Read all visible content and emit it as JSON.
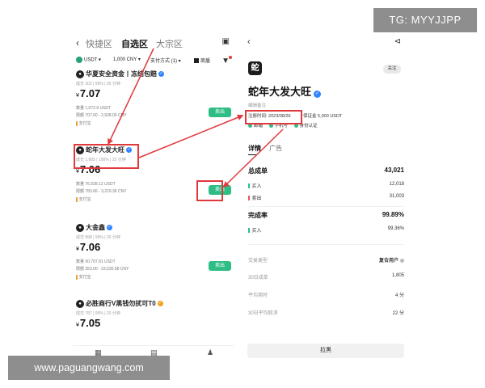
{
  "watermarks": {
    "telegram": "TG: MYYJJPP",
    "site": "www.paguangwang.com"
  },
  "left_panel": {
    "tabs": [
      "快捷区",
      "自选区",
      "大宗区"
    ],
    "active_tab": "自选区",
    "filter": {
      "asset": "USDT",
      "amount": "1,000 CNY",
      "payment": "支付方式 (1)",
      "checkbox_label": "商盾"
    },
    "offers": [
      {
        "name": "华夏安全资金丨冻结包赔",
        "stats": "成交 302   |   99%   |   20 分钟",
        "price": "7.07",
        "currency_symbol": "¥",
        "quantity": "数量  1,072.9 USDT",
        "limit": "限额  707.00 - 2,928.00 CNY",
        "payment": "支付宝",
        "action": "卖出",
        "badge": "blue"
      },
      {
        "name": "蛇年大发大旺",
        "stats": "成交 1,805  |  100%  |  22 分钟",
        "price": "7.06",
        "currency_symbol": "¥",
        "quantity": "数量  76,028.12 USDT",
        "limit": "限额  783.66 - 3,219.36 CNY",
        "payment": "支付宝",
        "action": "卖出",
        "badge": "blue"
      },
      {
        "name": "大金鑫",
        "stats": "成交 898   |   99%   |   20 分钟",
        "price": "7.06",
        "currency_symbol": "¥",
        "quantity": "数量  50,707.81 USDT",
        "limit": "限额  353.00 - 23,530.98 CNY",
        "payment": "支付宝",
        "action": "卖出",
        "badge": "blue"
      },
      {
        "name": "必胜商行V黑钱勿扰可T0",
        "stats": "成交 787   |   99%   |   20 分钟",
        "price": "7.05",
        "currency_symbol": "¥",
        "badge": "gold"
      }
    ]
  },
  "right_panel": {
    "avatar_char": "蛇",
    "follow_label": "关注",
    "merchant_name": "蛇年大发大旺",
    "remark": "编辑备注",
    "registration": "注册时间: 2023/08/26",
    "deposit": "保证金  5,000 USDT",
    "auth": [
      "邮箱",
      "手机号",
      "身份认证"
    ],
    "tabs": [
      "详情",
      "广告"
    ],
    "active_tab": "详情",
    "total_orders": {
      "label": "总成单",
      "value": "43,021"
    },
    "buy": {
      "label": "买入",
      "value": "12,018"
    },
    "sell": {
      "label": "卖出",
      "value": "31,003"
    },
    "completion": {
      "label": "完成率",
      "value": "99.89%"
    },
    "buy_rate": {
      "label": "买入",
      "value": "99.36%"
    },
    "trade_type": {
      "label": "交易类型",
      "value": "复合用户"
    },
    "orders_30d": {
      "label": "30日成单",
      "value": "1,805"
    },
    "avg_time": {
      "label": "平均用时",
      "value": "4 分"
    },
    "avg_cancel_30d": {
      "label": "30日平均取消",
      "value": "22 分"
    },
    "block_label": "拉黑"
  },
  "colors": {
    "accent_green": "#2ebd85",
    "annotation_red": "#e0393c",
    "verified_blue": "#2f86ff"
  }
}
